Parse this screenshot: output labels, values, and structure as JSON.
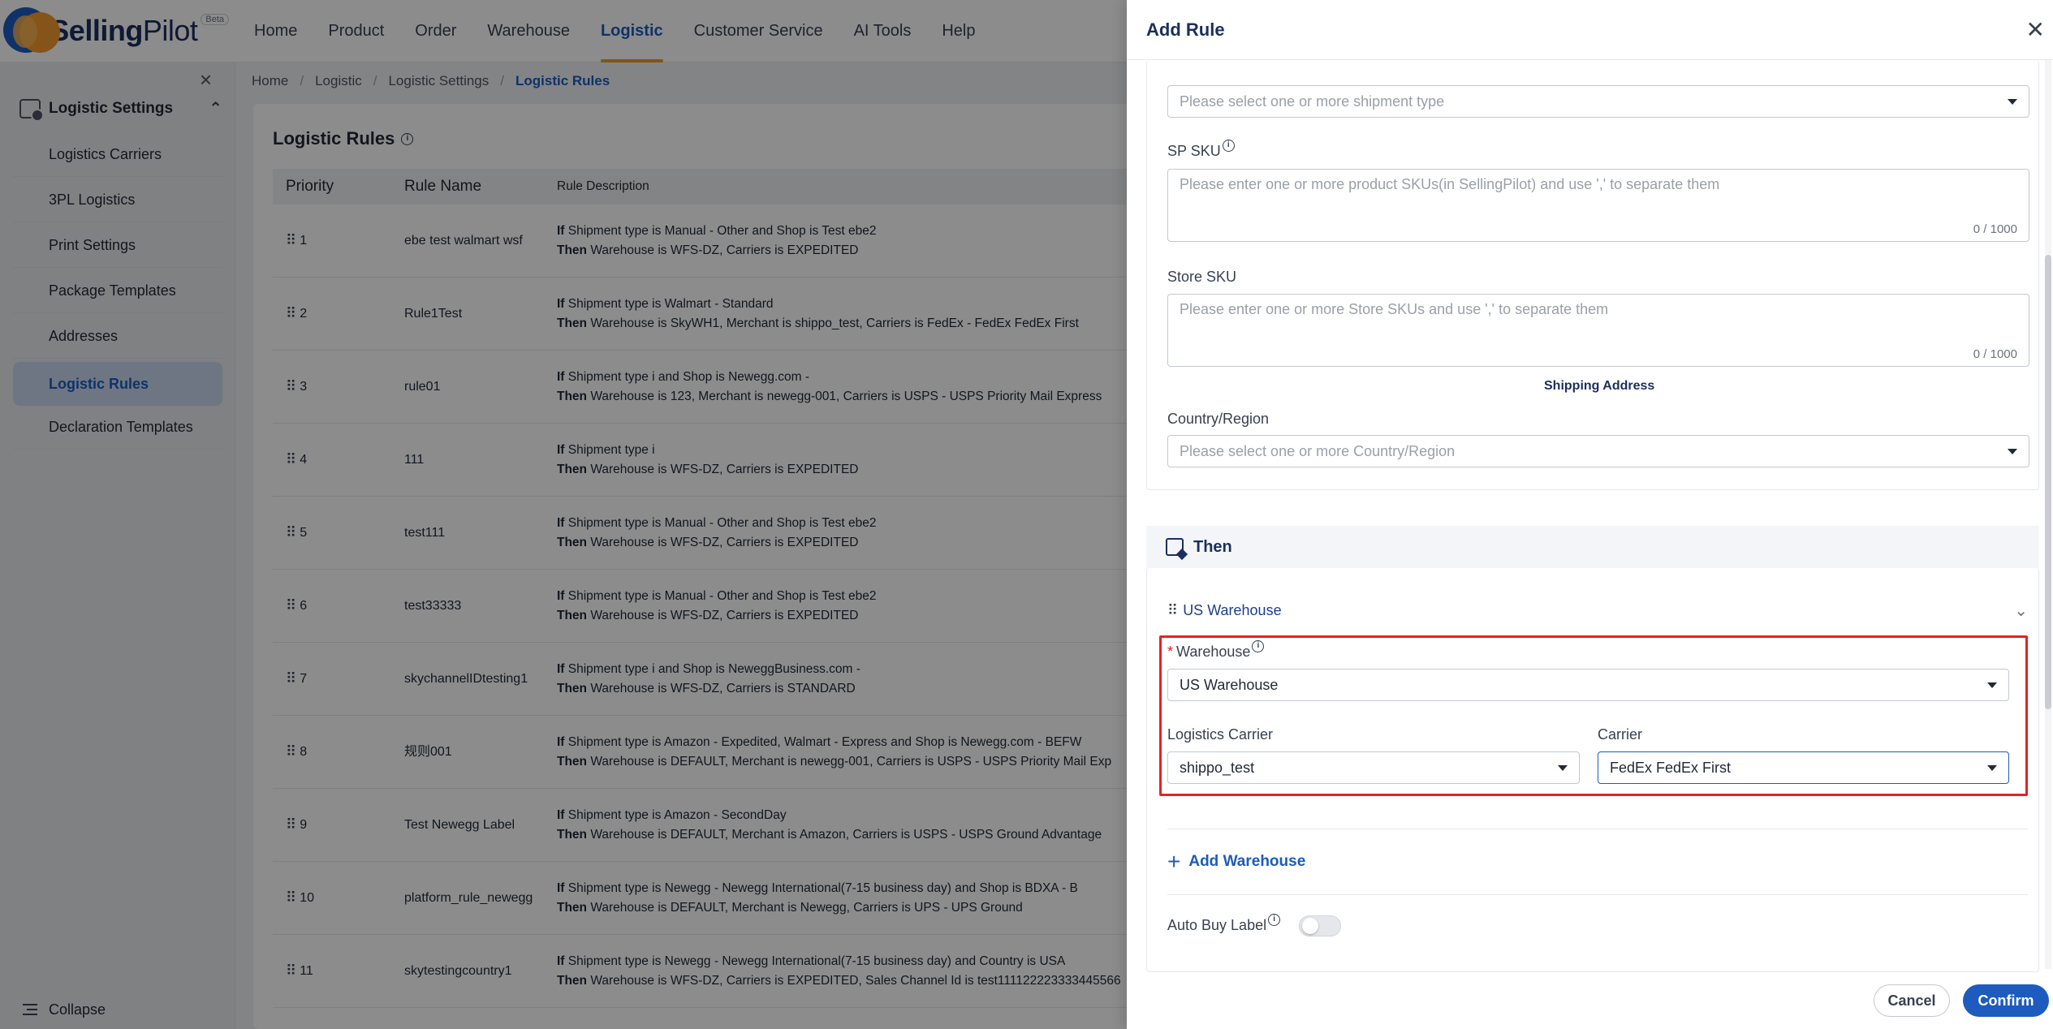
{
  "app": {
    "logo_text_bold": "Selling",
    "logo_text_light": "Pilot",
    "beta": "Beta"
  },
  "nav": {
    "items": [
      {
        "label": "Home"
      },
      {
        "label": "Product"
      },
      {
        "label": "Order"
      },
      {
        "label": "Warehouse"
      },
      {
        "label": "Logistic"
      },
      {
        "label": "Customer Service"
      },
      {
        "label": "AI Tools"
      },
      {
        "label": "Help"
      }
    ],
    "active": "Logistic"
  },
  "sidebar": {
    "group": "Logistic Settings",
    "items": [
      {
        "label": "Logistics Carriers"
      },
      {
        "label": "3PL Logistics"
      },
      {
        "label": "Print Settings"
      },
      {
        "label": "Package Templates"
      },
      {
        "label": "Addresses"
      },
      {
        "label": "Logistic Rules"
      },
      {
        "label": "Declaration Templates"
      }
    ],
    "active": "Logistic Rules",
    "collapse": "Collapse"
  },
  "breadcrumb": [
    "Home",
    "Logistic",
    "Logistic Settings",
    "Logistic Rules"
  ],
  "page": {
    "title": "Logistic Rules",
    "columns": {
      "priority": "Priority",
      "name": "Rule Name",
      "description": "Rule Description"
    },
    "rows": [
      {
        "priority": "1",
        "name": "ebe test walmart wsf",
        "if": "Shipment type is Manual - Other and Shop is Test ebe2",
        "then": "Warehouse is WFS-DZ, Carriers is EXPEDITED"
      },
      {
        "priority": "2",
        "name": "Rule1Test",
        "if": "Shipment type is Walmart - Standard",
        "then": "Warehouse is SkyWH1, Merchant is shippo_test, Carriers is FedEx - FedEx FedEx First"
      },
      {
        "priority": "3",
        "name": "rule01",
        "if": "Shipment type i and Shop is Newegg.com -",
        "then": "Warehouse is 123, Merchant is newegg-001, Carriers is USPS - USPS Priority Mail Express"
      },
      {
        "priority": "4",
        "name": "111",
        "if": "Shipment type i",
        "then": "Warehouse is WFS-DZ, Carriers is EXPEDITED"
      },
      {
        "priority": "5",
        "name": "test111",
        "if": "Shipment type is Manual - Other and Shop is Test ebe2",
        "then": "Warehouse is WFS-DZ, Carriers is EXPEDITED"
      },
      {
        "priority": "6",
        "name": "test33333",
        "if": "Shipment type is Manual - Other and Shop is Test ebe2",
        "then": "Warehouse is WFS-DZ, Carriers is EXPEDITED"
      },
      {
        "priority": "7",
        "name": "skychannelIDtesting1",
        "if": "Shipment type i and Shop is NeweggBusiness.com -",
        "then": "Warehouse is WFS-DZ, Carriers is STANDARD"
      },
      {
        "priority": "8",
        "name": "规则001",
        "if": "Shipment type is Amazon - Expedited, Walmart - Express and Shop is Newegg.com - BEFW",
        "then": "Warehouse is DEFAULT, Merchant is newegg-001, Carriers is USPS - USPS Priority Mail Exp"
      },
      {
        "priority": "9",
        "name": "Test Newegg Label",
        "if": "Shipment type is Amazon - SecondDay",
        "then": "Warehouse is DEFAULT, Merchant is Amazon, Carriers is USPS - USPS Ground Advantage"
      },
      {
        "priority": "10",
        "name": "platform_rule_newegg",
        "if": "Shipment type is Newegg - Newegg International(7-15 business day) and Shop is BDXA - B",
        "then": "Warehouse is DEFAULT, Merchant is Newegg, Carriers is UPS - UPS Ground"
      },
      {
        "priority": "11",
        "name": "skytestingcountry1",
        "if": "Shipment type is Newegg - Newegg International(7-15 business day) and Country is USA",
        "then": "Warehouse is WFS-DZ, Carriers is EXPEDITED, Sales Channel Id is test111122223333445566"
      }
    ],
    "if_word": "If",
    "then_word": "Then"
  },
  "drawer": {
    "title": "Add Rule",
    "shipment_type_placeholder": "Please select one or more shipment type",
    "sp_sku": {
      "label": "SP SKU",
      "placeholder": "Please enter one or more product SKUs(in SellingPilot) and use ',' to separate them",
      "count": "0 / 1000"
    },
    "store_sku": {
      "label": "Store SKU",
      "placeholder": "Please enter one or more Store SKUs and use ',' to separate them",
      "count": "0 / 1000"
    },
    "shipping_address": "Shipping Address",
    "country": {
      "label": "Country/Region",
      "placeholder": "Please select one or more Country/Region"
    },
    "then": "Then",
    "warehouse_section": "US Warehouse",
    "warehouse": {
      "label": "Warehouse",
      "value": "US Warehouse"
    },
    "logistics_carrier": {
      "label": "Logistics Carrier",
      "value": "shippo_test"
    },
    "carrier": {
      "label": "Carrier",
      "value": "FedEx FedEx First"
    },
    "add_warehouse": "Add Warehouse",
    "auto_buy_label": "Auto Buy Label",
    "auto_buy_on": false,
    "cancel": "Cancel",
    "confirm": "Confirm"
  },
  "colors": {
    "accent": "#1d5bbf",
    "highlight": "#e02424",
    "tab_underline": "#f39a2e"
  }
}
